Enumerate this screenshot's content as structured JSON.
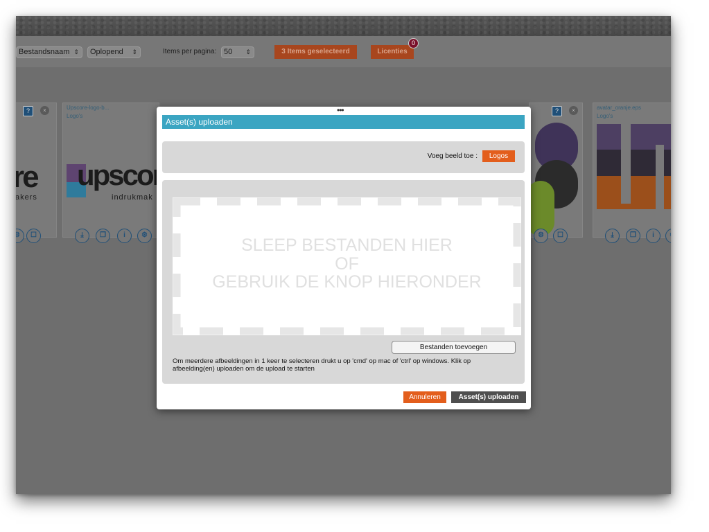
{
  "toolbar": {
    "sort_field": "Bestandsnaam",
    "sort_order": "Oplopend",
    "items_per_page_label": "Items per pagina:",
    "items_per_page_value": "50",
    "selected_button": "3 Items geselecteerd",
    "licenses_button": "Licenties",
    "licenses_count": "0"
  },
  "cards": [
    {
      "name": "",
      "category": "",
      "logo_text": "re",
      "logo_sub": "akers"
    },
    {
      "name": "Upscore-logo-b...",
      "category": "Logo's",
      "logo_text": "upscor",
      "logo_sub": "indrukmak"
    },
    {
      "name": "",
      "category": "",
      "logo_text": "",
      "logo_sub": ""
    },
    {
      "name": "",
      "category": "",
      "logo_text": "",
      "logo_sub": ""
    },
    {
      "name": "",
      "category": "",
      "logo_text": "",
      "logo_sub": ""
    },
    {
      "name": "avatar_oranje.eps",
      "category": "Logo's",
      "logo_text": "",
      "logo_sub": ""
    }
  ],
  "modal": {
    "drag_handle": "•••",
    "title": "Asset(s) uploaden",
    "category_label": "Voeg beeld toe :",
    "category_button": "Logos",
    "dropzone": {
      "line1": "SLEEP BESTANDEN HIER",
      "line2": "OF",
      "line3": "GEBRUIK DE KNOP HIERONDER"
    },
    "add_files_button": "Bestanden toevoegen",
    "hint": "Om meerdere afbeeldingen in 1 keer te selecteren drukt u op 'cmd' op mac of 'ctrl' op windows. Klik op afbeelding(en) uploaden om de upload te starten",
    "cancel_button": "Annuleren",
    "submit_button": "Asset(s) uploaden"
  },
  "colors": {
    "title_bar": "#3ba5c2",
    "accent_orange": "#e35e1c",
    "dark_button": "#4f4f4f",
    "overlay": "#6e6e6e"
  }
}
